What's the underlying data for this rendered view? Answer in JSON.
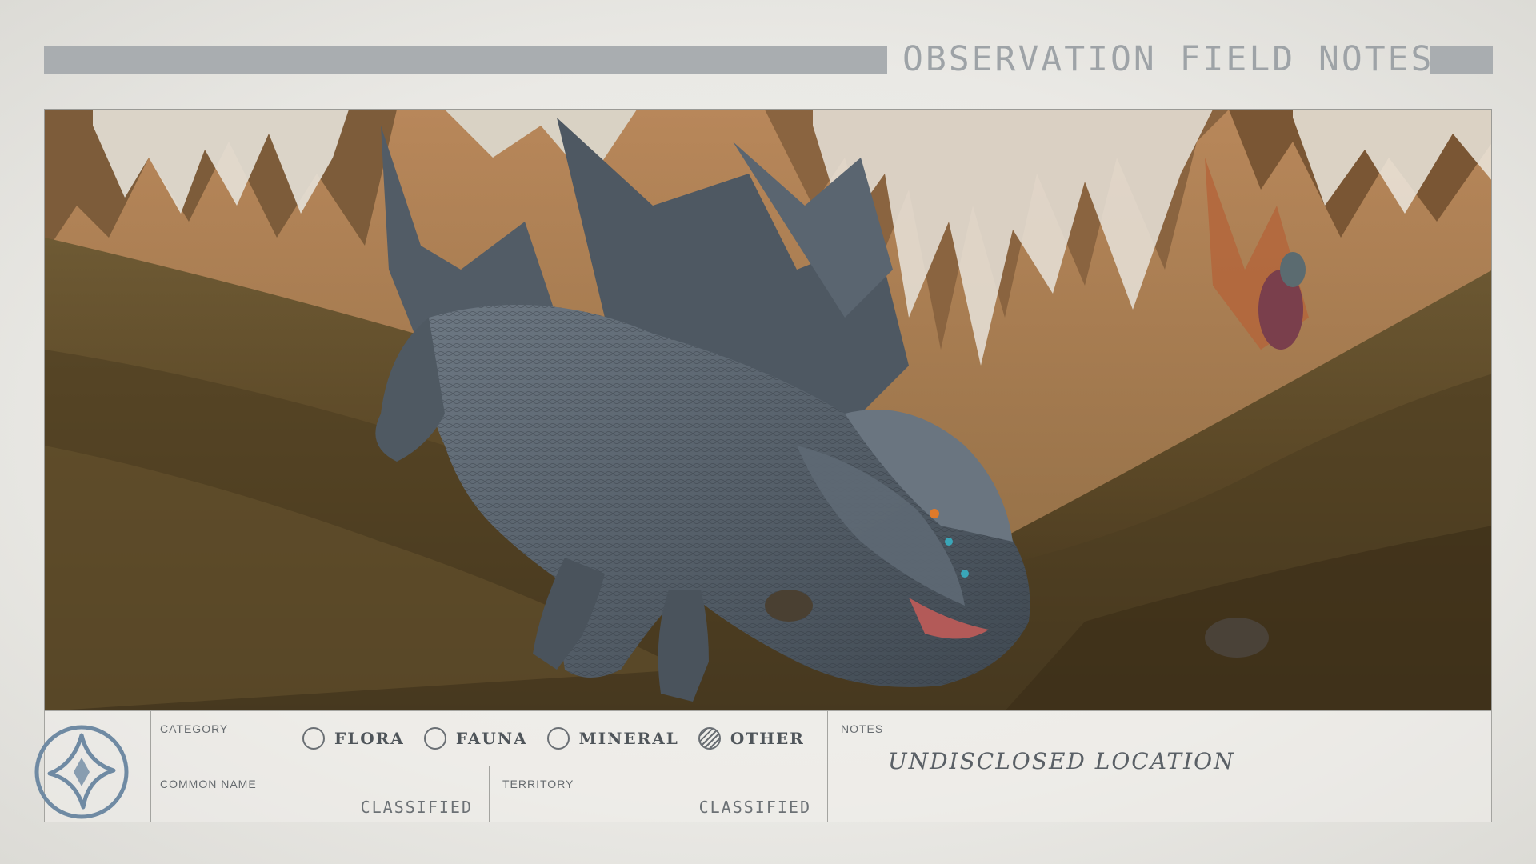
{
  "header": {
    "title": "OBSERVATION FIELD NOTES"
  },
  "photo": {
    "subject": "dragon-creature",
    "sky_color": "#c8a77a",
    "ground_color": "#5e4a2c",
    "creature_color": "#5b6670"
  },
  "form": {
    "category": {
      "label": "CATEGORY",
      "options": [
        {
          "label": "FLORA",
          "checked": false
        },
        {
          "label": "FAUNA",
          "checked": false
        },
        {
          "label": "MINERAL",
          "checked": false
        },
        {
          "label": "OTHER",
          "checked": true
        }
      ]
    },
    "common_name": {
      "label": "COMMON NAME",
      "value": "CLASSIFIED"
    },
    "territory": {
      "label": "TERRITORY",
      "value": "CLASSIFIED"
    },
    "notes": {
      "label": "NOTES",
      "value": "UNDISCLOSED LOCATION"
    },
    "emblem_icon": "star-compass-icon"
  },
  "colors": {
    "paper": "#eceae6",
    "bar": "#a9adb0",
    "ink": "#4f555a",
    "emblem": "#6f8aa3"
  }
}
